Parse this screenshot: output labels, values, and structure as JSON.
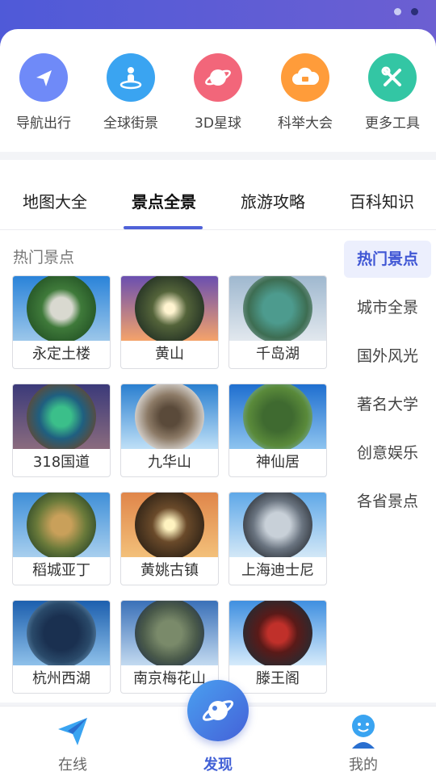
{
  "colors": {
    "header": "#5b5cd6",
    "accent": "#4f62d8",
    "active_side_bg": "#eceffd"
  },
  "tools": [
    {
      "label": "导航出行",
      "icon": "navigation-arrow-icon",
      "color": "#6f8af8"
    },
    {
      "label": "全球街景",
      "icon": "street-view-person-icon",
      "color": "#3aa4f1"
    },
    {
      "label": "3D星球",
      "icon": "planet-ring-icon",
      "color": "#f2667a"
    },
    {
      "label": "科举大会",
      "icon": "cloud-exam-icon",
      "color": "#ff9c3a"
    },
    {
      "label": "更多工具",
      "icon": "wrench-screwdriver-icon",
      "color": "#33c6a4"
    }
  ],
  "tabs": [
    {
      "label": "地图大全"
    },
    {
      "label": "景点全景"
    },
    {
      "label": "旅游攻略"
    },
    {
      "label": "百科知识"
    }
  ],
  "active_tab": "景点全景",
  "section_title": "热门景点",
  "spots": [
    {
      "name": "永定土楼"
    },
    {
      "name": "黄山"
    },
    {
      "name": "千岛湖"
    },
    {
      "name": "318国道"
    },
    {
      "name": "九华山"
    },
    {
      "name": "神仙居"
    },
    {
      "name": "稻城亚丁"
    },
    {
      "name": "黄姚古镇"
    },
    {
      "name": "上海迪士尼"
    },
    {
      "name": "杭州西湖"
    },
    {
      "name": "南京梅花山"
    },
    {
      "name": "滕王阁"
    }
  ],
  "categories": [
    {
      "label": "热门景点"
    },
    {
      "label": "城市全景"
    },
    {
      "label": "国外风光"
    },
    {
      "label": "著名大学"
    },
    {
      "label": "创意娱乐"
    },
    {
      "label": "各省景点"
    }
  ],
  "active_category": "热门景点",
  "bottom_nav": [
    {
      "label": "在线",
      "icon": "paper-plane-icon"
    },
    {
      "label": "发现",
      "icon": "planet-icon"
    },
    {
      "label": "我的",
      "icon": "user-avatar-icon"
    }
  ],
  "active_nav": "发现"
}
